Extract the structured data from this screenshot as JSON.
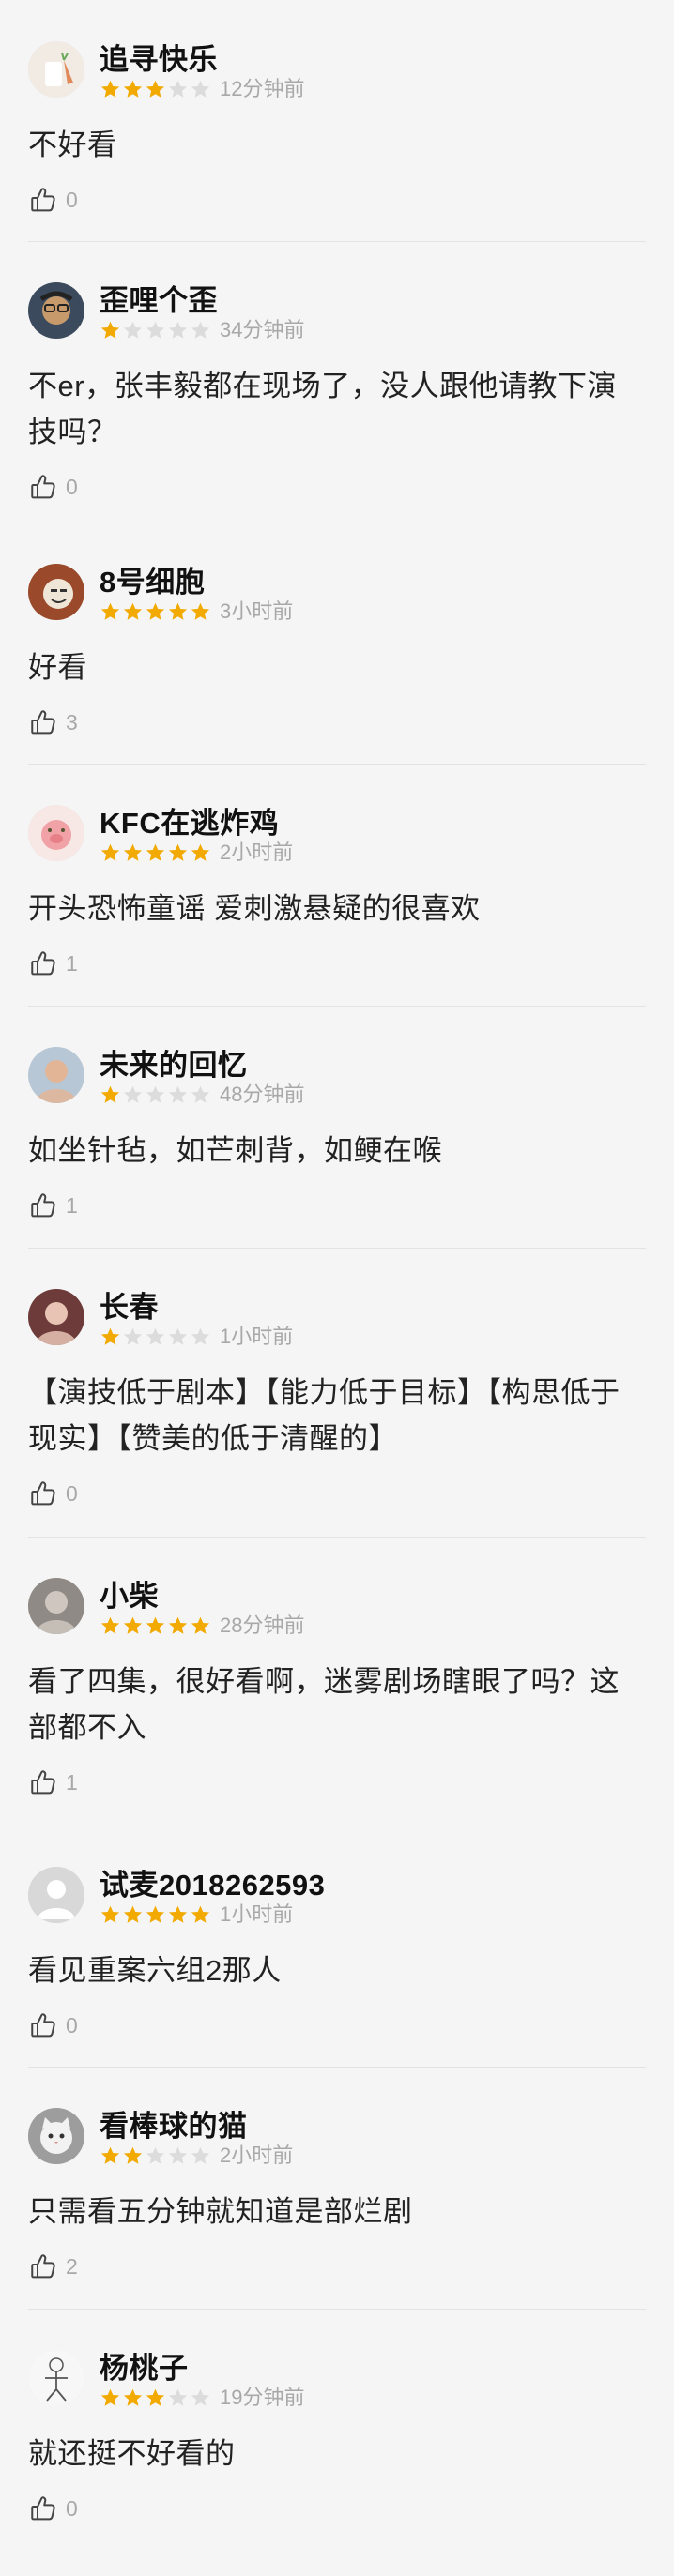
{
  "comments": [
    {
      "username": "追寻快乐",
      "rating": 3,
      "time": "12分钟前",
      "text": "不好看",
      "likes": "0",
      "avatar": {
        "icon": "carrot-drink-avatar",
        "bg": "#f2ebe4",
        "fg": "#e08a5a"
      }
    },
    {
      "username": "歪哩个歪",
      "rating": 1,
      "time": "34分钟前",
      "text": "不er，张丰毅都在现场了，没人跟他请教下演技吗？",
      "likes": "0",
      "avatar": {
        "icon": "glasses-man-avatar",
        "bg": "#3b4a5c",
        "fg": "#c79a6c"
      }
    },
    {
      "username": "8号细胞",
      "rating": 5,
      "time": "3小时前",
      "text": "好看",
      "likes": "3",
      "avatar": {
        "icon": "meme-face-avatar",
        "bg": "#9a4a2a",
        "fg": "#f0e6d8"
      }
    },
    {
      "username": "KFC在逃炸鸡",
      "rating": 5,
      "time": "2小时前",
      "text": "开头恐怖童谣 爱刺激悬疑的很喜欢",
      "likes": "1",
      "avatar": {
        "icon": "pink-pig-avatar",
        "bg": "#f7e8e6",
        "fg": "#f0a2a6"
      }
    },
    {
      "username": "未来的回忆",
      "rating": 1,
      "time": "48分钟前",
      "text": "如坐针毡，如芒刺背，如鲠在喉",
      "likes": "1",
      "avatar": {
        "icon": "boy-portrait-avatar",
        "bg": "#b8c7d6",
        "fg": "#e2b596"
      }
    },
    {
      "username": "长春",
      "rating": 1,
      "time": "1小时前",
      "text": "【演技低于剧本】【能力低于目标】【构思低于现实】【赞美的低于清醒的】",
      "likes": "0",
      "avatar": {
        "icon": "girl-portrait-avatar",
        "bg": "#6e3b3b",
        "fg": "#e8c4b4"
      }
    },
    {
      "username": "小柴",
      "rating": 5,
      "time": "28分钟前",
      "text": "看了四集，很好看啊，迷雾剧场瞎眼了吗？这部都不入",
      "likes": "1",
      "avatar": {
        "icon": "room-photo-avatar",
        "bg": "#8f8a86",
        "fg": "#cfc7bf"
      }
    },
    {
      "username": "试麦2018262593",
      "rating": 5,
      "time": "1小时前",
      "text": "看见重案六组2那人",
      "likes": "0",
      "avatar": {
        "icon": "default-user-avatar",
        "bg": "#d8d8d8",
        "fg": "#ffffff"
      }
    },
    {
      "username": "看棒球的猫",
      "rating": 2,
      "time": "2小时前",
      "text": "只需看五分钟就知道是部烂剧",
      "likes": "2",
      "avatar": {
        "icon": "cat-face-avatar",
        "bg": "#9d9d9d",
        "fg": "#f2f2f2"
      }
    },
    {
      "username": "杨桃子",
      "rating": 3,
      "time": "19分钟前",
      "text": "就还挺不好看的",
      "likes": "0",
      "avatar": {
        "icon": "sketch-figure-avatar",
        "bg": "#f7f7f7",
        "fg": "#555555"
      }
    }
  ],
  "colors": {
    "star_on": "#f2a900",
    "star_off": "#dcdcdc",
    "muted_text": "#a8a8a8",
    "background": "#f5f5f5"
  },
  "icons": {
    "like": "thumbs-up-icon",
    "star": "star-icon"
  }
}
